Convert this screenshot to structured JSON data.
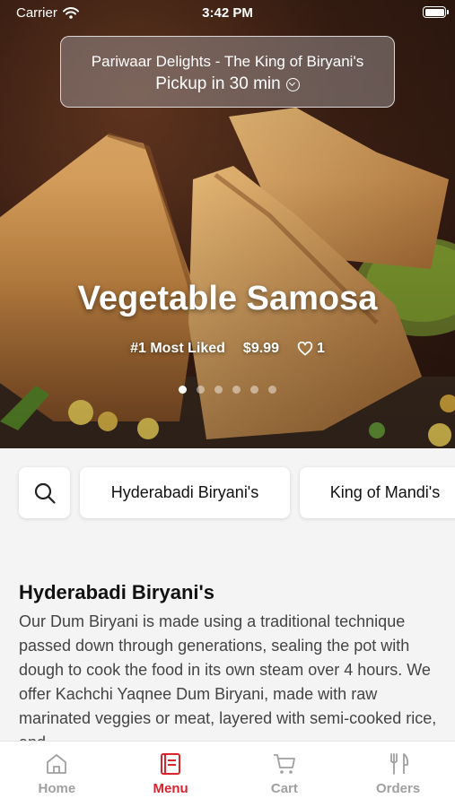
{
  "status_bar": {
    "carrier": "Carrier",
    "time": "3:42 PM"
  },
  "header": {
    "restaurant_name": "Pariwaar Delights - The King of Biryani's",
    "pickup_text": "Pickup in 30 min"
  },
  "featured": {
    "title": "Vegetable Samosa",
    "badge": "#1 Most Liked",
    "price": "$9.99",
    "likes": "1",
    "carousel_total": 6,
    "carousel_active": 1
  },
  "categories": [
    "Hyderabadi Biryani's",
    "King of Mandi's"
  ],
  "section": {
    "title": "Hyderabadi Biryani's",
    "description": "Our Dum Biryani is made using a traditional technique passed down through generations, sealing the pot with dough to cook the food in its own steam over 4 hours. We offer Kachchi Yaqnee Dum Biryani, made with raw marinated veggies or meat, layered with semi-cooked rice, and"
  },
  "tabs": [
    {
      "label": "Home",
      "icon": "home-icon",
      "active": false
    },
    {
      "label": "Menu",
      "icon": "menu-icon",
      "active": true
    },
    {
      "label": "Cart",
      "icon": "cart-icon",
      "active": false
    },
    {
      "label": "Orders",
      "icon": "orders-icon",
      "active": false
    }
  ],
  "colors": {
    "accent": "#d9232d",
    "inactive": "#a0a0a0"
  }
}
